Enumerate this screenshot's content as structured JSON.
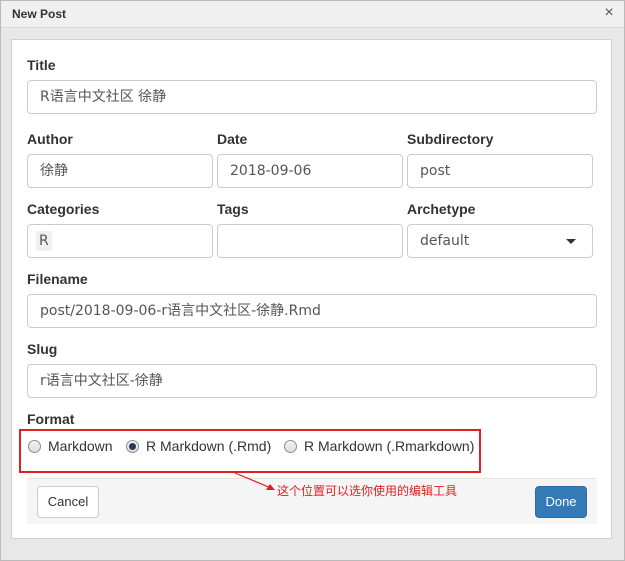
{
  "window": {
    "title": "New Post",
    "close_glyph": "×"
  },
  "form": {
    "title": {
      "label": "Title",
      "value": "R语言中文社区 徐静"
    },
    "author": {
      "label": "Author",
      "value": "徐静"
    },
    "date": {
      "label": "Date",
      "value": "2018-09-06"
    },
    "subdirectory": {
      "label": "Subdirectory",
      "value": "post"
    },
    "categories": {
      "label": "Categories",
      "chip": "R"
    },
    "tags": {
      "label": "Tags",
      "value": ""
    },
    "archetype": {
      "label": "Archetype",
      "value": "default"
    },
    "filename": {
      "label": "Filename",
      "value": "post/2018-09-06-r语言中文社区-徐静.Rmd"
    },
    "slug": {
      "label": "Slug",
      "value": "r语言中文社区-徐静"
    },
    "format": {
      "label": "Format",
      "options": [
        "Markdown",
        "R Markdown (.Rmd)",
        "R Markdown (.Rmarkdown)"
      ],
      "selected": "R Markdown (.Rmd)"
    }
  },
  "annotation": {
    "text": "这个位置可以选你使用的编辑工具",
    "color": "#e02020"
  },
  "buttons": {
    "cancel": "Cancel",
    "done": "Done",
    "done_color": "#337ab7"
  },
  "icons": {
    "close": "close-icon",
    "dropdown": "chevron-down-icon",
    "annotation_arrow": "arrow-icon"
  }
}
